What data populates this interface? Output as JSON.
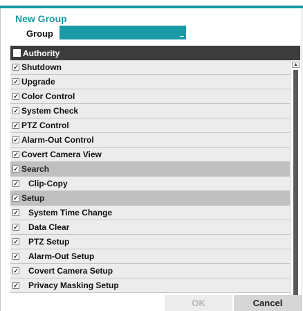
{
  "dialog": {
    "title": "New Group"
  },
  "group": {
    "label": "Group",
    "value": ""
  },
  "list": {
    "header": "Authority",
    "items": [
      {
        "label": "Shutdown",
        "checked": true,
        "type": "item"
      },
      {
        "label": "Upgrade",
        "checked": true,
        "type": "item"
      },
      {
        "label": "Color Control",
        "checked": true,
        "type": "item"
      },
      {
        "label": "System Check",
        "checked": true,
        "type": "item"
      },
      {
        "label": "PTZ Control",
        "checked": true,
        "type": "item"
      },
      {
        "label": "Alarm-Out Control",
        "checked": true,
        "type": "item"
      },
      {
        "label": "Covert Camera View",
        "checked": true,
        "type": "item"
      },
      {
        "label": "Search",
        "checked": true,
        "type": "section"
      },
      {
        "label": "Clip-Copy",
        "checked": true,
        "type": "child"
      },
      {
        "label": "Setup",
        "checked": true,
        "type": "section"
      },
      {
        "label": "System Time Change",
        "checked": true,
        "type": "child"
      },
      {
        "label": "Data Clear",
        "checked": true,
        "type": "child"
      },
      {
        "label": "PTZ Setup",
        "checked": true,
        "type": "child"
      },
      {
        "label": "Alarm-Out Setup",
        "checked": true,
        "type": "child"
      },
      {
        "label": "Covert Camera Setup",
        "checked": true,
        "type": "child"
      },
      {
        "label": "Privacy Masking Setup",
        "checked": true,
        "type": "child"
      }
    ]
  },
  "buttons": {
    "ok": "OK",
    "cancel": "Cancel"
  },
  "colors": {
    "accent": "#1a9aa6",
    "header": "#3c3c3c",
    "row": "#ececec",
    "section": "#c0c0c0"
  }
}
